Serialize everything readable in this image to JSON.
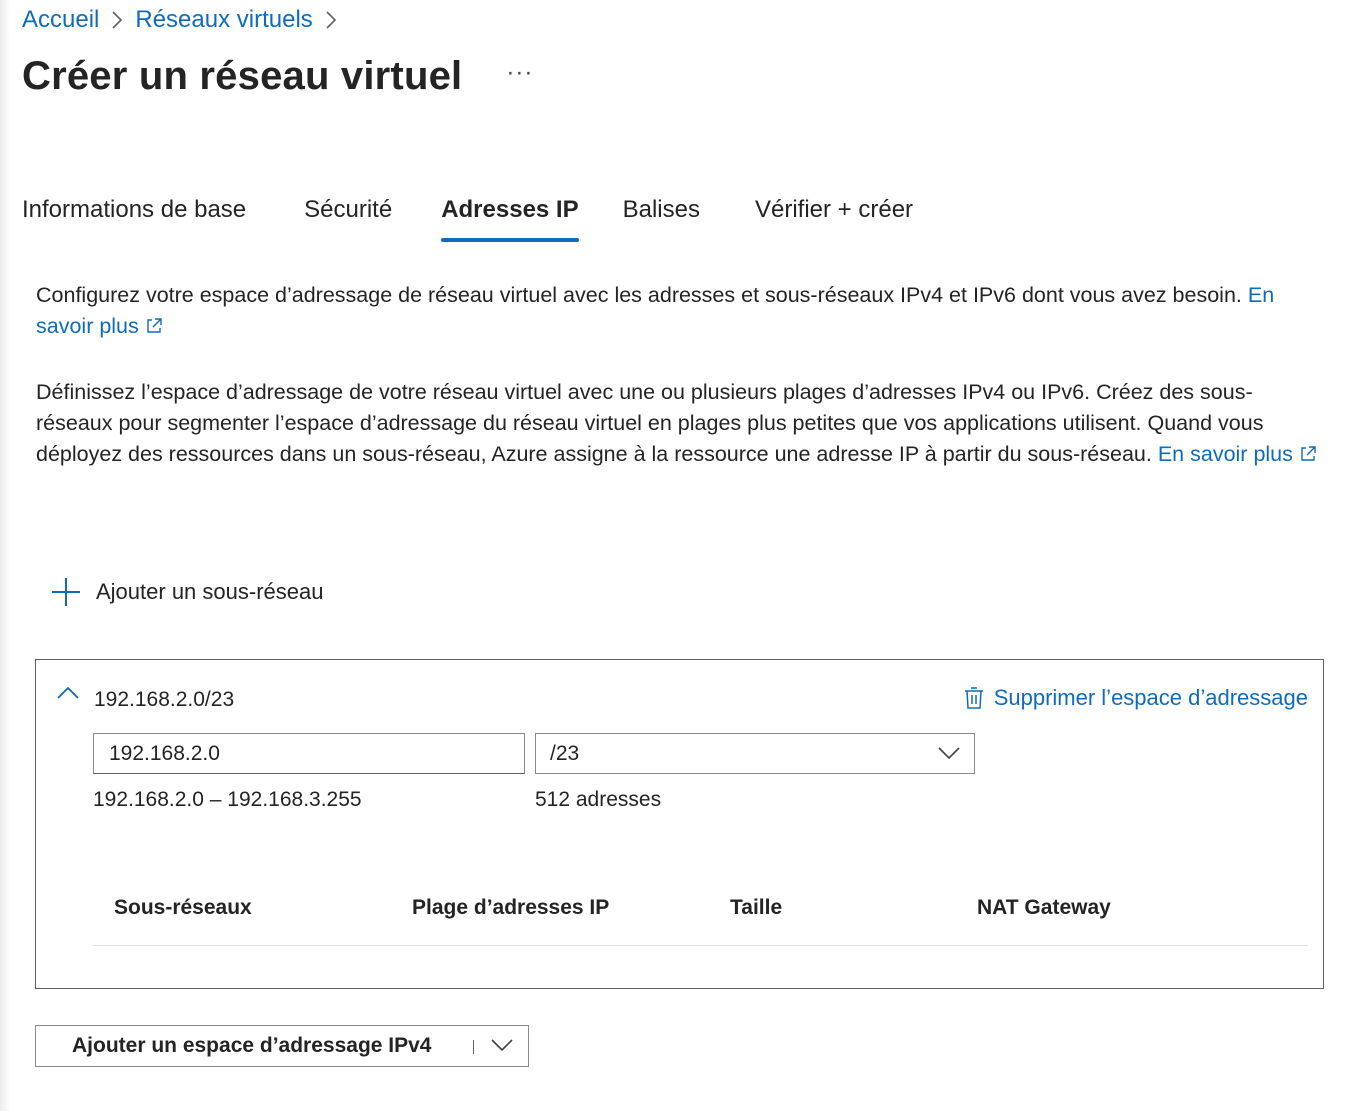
{
  "breadcrumb": {
    "items": [
      "Accueil",
      "Réseaux virtuels"
    ]
  },
  "header": {
    "title": "Créer un réseau virtuel",
    "more": "···"
  },
  "tabs": [
    {
      "label": "Informations de base",
      "active": false
    },
    {
      "label": "Sécurité",
      "active": false
    },
    {
      "label": "Adresses IP",
      "active": true
    },
    {
      "label": "Balises",
      "active": false
    },
    {
      "label": "Vérifier + créer",
      "active": false
    }
  ],
  "intro": {
    "text1": "Configurez votre espace d’adressage de réseau virtuel avec les adresses et sous-réseaux IPv4 et IPv6 dont vous avez besoin.",
    "link1": "En savoir plus",
    "text2": "Définissez l’espace d’adressage de votre réseau virtuel avec une ou plusieurs plages d’adresses IPv4 ou IPv6. Créez des sous-réseaux pour segmenter l’espace d’adressage du réseau virtuel en plages plus petites que vos applications utilisent. Quand vous déployez des ressources dans un sous-réseau, Azure assigne à la ressource une adresse IP à partir du sous-réseau.",
    "link2": "En savoir plus"
  },
  "actions": {
    "add_subnet": "Ajouter un sous-réseau",
    "add_address_space": "Ajouter un espace d’adressage IPv4"
  },
  "address_space": {
    "title": "192.168.2.0/23",
    "delete_label": "Supprimer l’espace d’adressage",
    "ip_value": "192.168.2.0",
    "prefix_value": "/23",
    "range": "192.168.2.0 – 192.168.3.255",
    "count": "512 adresses",
    "columns": [
      "Sous-réseaux",
      "Plage d’adresses IP",
      "Taille",
      "NAT Gateway"
    ]
  },
  "colors": {
    "accent": "#0f6cbd",
    "text": "#242424",
    "border": "#616161"
  }
}
